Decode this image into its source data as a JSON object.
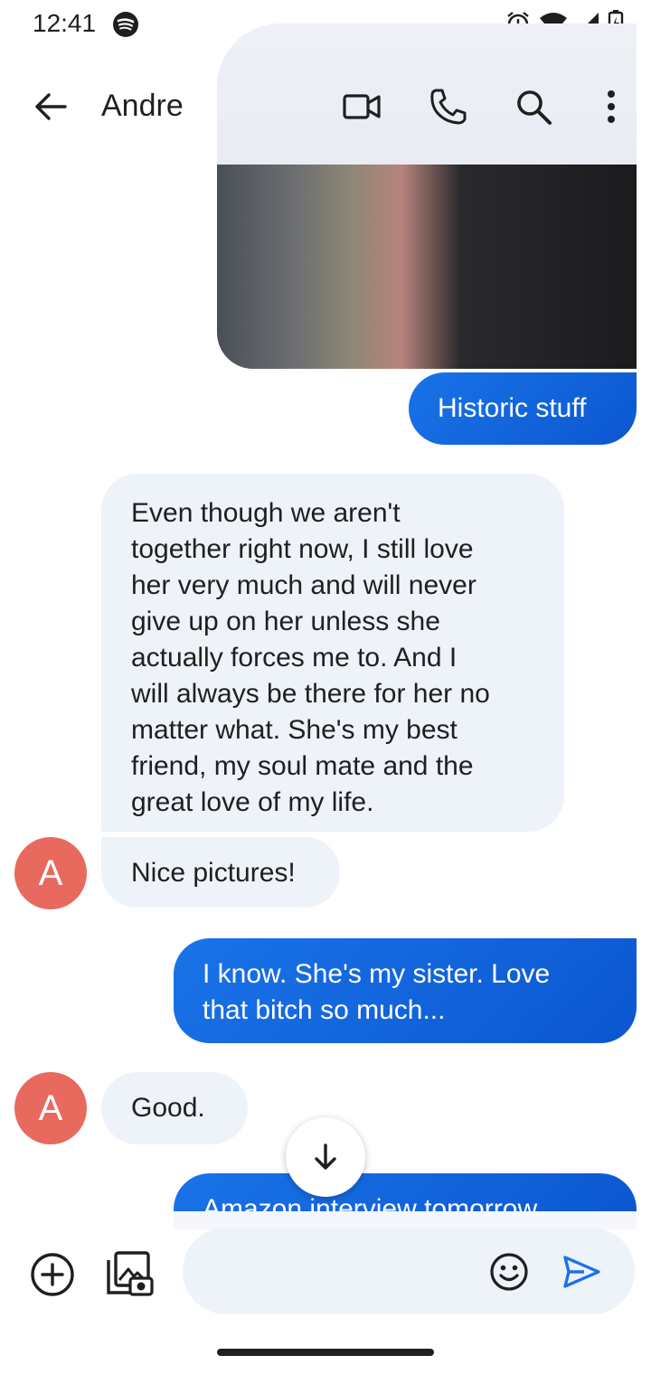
{
  "status_bar": {
    "time": "12:41",
    "icons": [
      "spotify-icon",
      "alarm-icon",
      "wifi-icon",
      "cell-signal-icon",
      "battery-icon"
    ]
  },
  "app_bar": {
    "contact_name": "Andre",
    "icons": [
      "back-arrow-icon",
      "video-call-icon",
      "phone-icon",
      "search-icon",
      "more-vert-icon"
    ]
  },
  "messages": [
    {
      "direction": "outgoing",
      "type": "image"
    },
    {
      "direction": "outgoing",
      "text": "Historic stuff"
    },
    {
      "direction": "incoming",
      "text": "Even though we aren't\ntogether right now, I still love\nher very much and will never\ngive up on her unless she\nactually forces me to. And I\nwill always be there for her no\nmatter what. She's my best\nfriend, my soul mate and the\ngreat love of my life."
    },
    {
      "direction": "incoming",
      "text": "Nice pictures!",
      "avatar": "A"
    },
    {
      "direction": "outgoing",
      "text": "I know. She's my sister. Love\nthat bitch so much..."
    },
    {
      "direction": "incoming",
      "text": "Good.",
      "avatar": "A"
    },
    {
      "direction": "outgoing",
      "text": "Amazon interview tomorrow"
    }
  ],
  "compose": {
    "value": "",
    "icons": [
      "add-circle-icon",
      "gallery-icon",
      "emoji-icon",
      "send-icon"
    ]
  },
  "colors": {
    "outgoing_bubble": "#1a73e8",
    "incoming_bubble": "#eef2f9",
    "avatar": "#e8695d",
    "accent": "#1a73e8"
  }
}
